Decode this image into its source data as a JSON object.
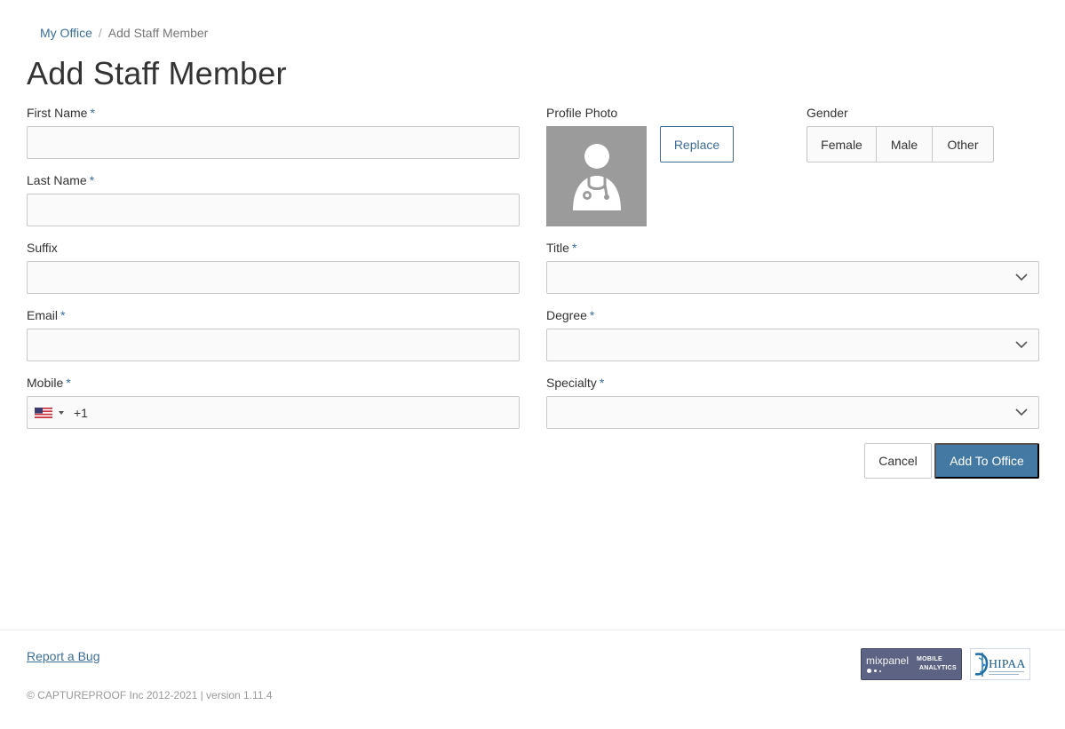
{
  "breadcrumb": {
    "home": "My Office",
    "separator": "/",
    "current": "Add Staff Member"
  },
  "page_title": "Add Staff Member",
  "required_marker": "*",
  "fields": {
    "first_name": {
      "label": "First Name",
      "value": ""
    },
    "last_name": {
      "label": "Last Name",
      "value": ""
    },
    "suffix": {
      "label": "Suffix",
      "value": ""
    },
    "email": {
      "label": "Email",
      "value": ""
    },
    "mobile": {
      "label": "Mobile",
      "country_code": "+1",
      "country_flag": "us-flag-icon"
    },
    "title": {
      "label": "Title",
      "selected": ""
    },
    "degree": {
      "label": "Degree",
      "selected": ""
    },
    "specialty": {
      "label": "Specialty",
      "selected": ""
    }
  },
  "profile_photo": {
    "label": "Profile Photo",
    "replace_label": "Replace",
    "placeholder_icon": "doctor-avatar-icon"
  },
  "gender": {
    "label": "Gender",
    "options": [
      "Female",
      "Male",
      "Other"
    ]
  },
  "actions": {
    "cancel": "Cancel",
    "submit": "Add To Office"
  },
  "footer": {
    "report_bug": "Report a Bug",
    "copyright": "© CAPTUREPROOF Inc 2012-2021 | version 1.11.4",
    "badges": {
      "mixpanel": {
        "brand": "mixpanel",
        "line1": "MOBILE",
        "line2": "ANALYTICS"
      },
      "hipaa": {
        "text": "HIPAA"
      }
    }
  },
  "colors": {
    "accent": "#3d6e98",
    "primary_button": "#4479a4",
    "field_border": "#c8c8c8",
    "field_bg": "#fafafa",
    "photo_bg": "#9b9b9b"
  }
}
